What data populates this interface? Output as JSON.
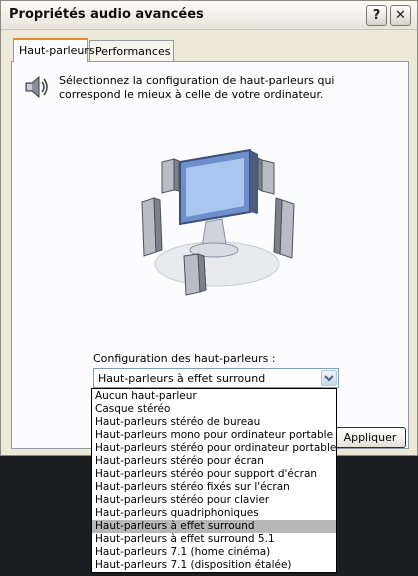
{
  "window": {
    "title": "Propriétés audio avancées"
  },
  "titlebar": {
    "help_glyph": "?",
    "close_glyph": "✕"
  },
  "tabs": [
    {
      "label": "Haut-parleurs",
      "active": true
    },
    {
      "label": "Performances",
      "active": false
    }
  ],
  "panel": {
    "description": "Sélectionnez la configuration de haut-parleurs qui correspond le mieux à celle de votre ordinateur.",
    "icons": {
      "speaker": "speaker-icon",
      "illustration": "computer-with-speakers-illustration"
    },
    "config_label": "Configuration des haut-parleurs :",
    "selected_value": "Haut-parleurs à effet surround"
  },
  "buttons": {
    "apply": "Appliquer"
  },
  "dropdown": {
    "options": [
      "Aucun haut-parleur",
      "Casque stéréo",
      "Haut-parleurs stéréo de bureau",
      "Haut-parleurs mono pour ordinateur portable",
      "Haut-parleurs stéréo pour ordinateur portable",
      "Haut-parleurs stéréo pour écran",
      "Haut-parleurs stéréo pour support d'écran",
      "Haut-parleurs stéréo fixés sur l'écran",
      "Haut-parleurs stéréo pour clavier",
      "Haut-parleurs quadriphoniques",
      "Haut-parleurs à effet surround",
      "Haut-parleurs à effet surround 5.1",
      "Haut-parleurs 7.1 (home cinéma)",
      "Haut-parleurs 7.1 (disposition étalée)"
    ],
    "selected_index": 10
  },
  "colors": {
    "tab_accent": "#e68b2c",
    "selection": "#b8b8b8",
    "combo_border": "#7f9db9"
  }
}
